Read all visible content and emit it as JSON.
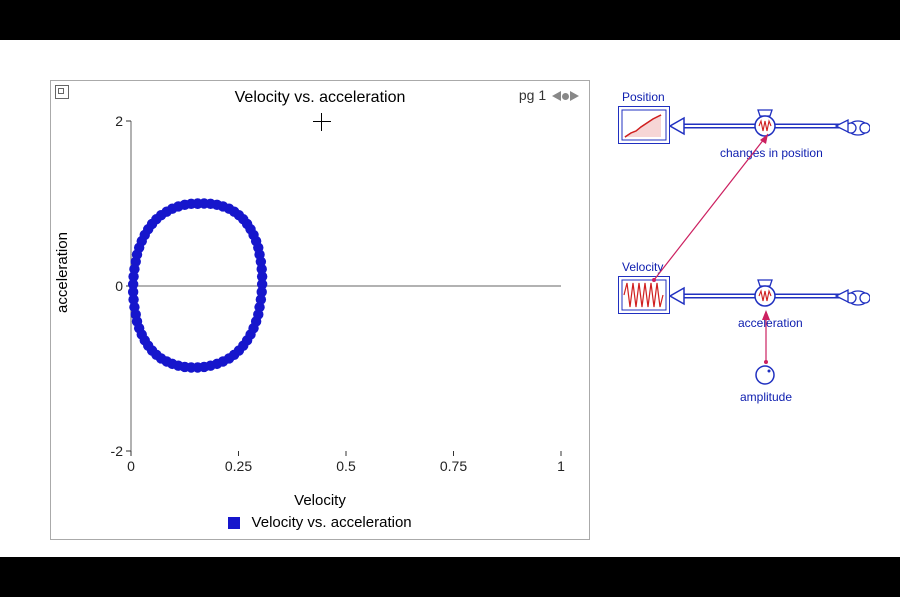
{
  "chart_data": {
    "type": "scatter",
    "title": "Velocity vs. acceleration",
    "xlabel": "Velocity",
    "ylabel": "acceleration",
    "xlim": [
      0,
      1
    ],
    "ylim": [
      -2,
      2
    ],
    "xticks": [
      0,
      0.25,
      0.5,
      0.75,
      1
    ],
    "yticks": [
      -2,
      0,
      2
    ],
    "grid": false,
    "series": [
      {
        "name": "Velocity vs. acceleration",
        "color": "#1616cc",
        "marker": "circle",
        "x": [
          0.155,
          0.14,
          0.125,
          0.11,
          0.096,
          0.083,
          0.07,
          0.059,
          0.049,
          0.04,
          0.032,
          0.025,
          0.019,
          0.014,
          0.011,
          0.008,
          0.006,
          0.005,
          0.005,
          0.006,
          0.008,
          0.011,
          0.014,
          0.019,
          0.025,
          0.032,
          0.04,
          0.049,
          0.059,
          0.07,
          0.083,
          0.096,
          0.11,
          0.125,
          0.14,
          0.155,
          0.17,
          0.185,
          0.2,
          0.214,
          0.228,
          0.24,
          0.251,
          0.261,
          0.27,
          0.278,
          0.285,
          0.291,
          0.296,
          0.299,
          0.302,
          0.304,
          0.305,
          0.305,
          0.304,
          0.302,
          0.299,
          0.296,
          0.291,
          0.285,
          0.278,
          0.27,
          0.261,
          0.251,
          0.24,
          0.228,
          0.214,
          0.2,
          0.185,
          0.17,
          0.155
        ],
        "y": [
          1.0,
          0.996,
          0.984,
          0.964,
          0.937,
          0.901,
          0.858,
          0.809,
          0.752,
          0.688,
          0.619,
          0.544,
          0.465,
          0.381,
          0.294,
          0.205,
          0.114,
          0.021,
          -0.072,
          -0.165,
          -0.256,
          -0.345,
          -0.43,
          -0.511,
          -0.588,
          -0.659,
          -0.724,
          -0.782,
          -0.834,
          -0.878,
          -0.915,
          -0.944,
          -0.966,
          -0.981,
          -0.988,
          -0.988,
          -0.981,
          -0.966,
          -0.944,
          -0.915,
          -0.878,
          -0.834,
          -0.782,
          -0.724,
          -0.659,
          -0.588,
          -0.511,
          -0.43,
          -0.345,
          -0.256,
          -0.165,
          -0.072,
          0.021,
          0.114,
          0.205,
          0.294,
          0.381,
          0.465,
          0.544,
          0.619,
          0.688,
          0.752,
          0.809,
          0.858,
          0.901,
          0.937,
          0.964,
          0.984,
          0.996,
          1.0,
          0.996
        ]
      }
    ],
    "cursor_position": {
      "x": 0.5,
      "y": 1.9
    }
  },
  "chart_ui": {
    "page_label": "pg 1",
    "legend_text": "Velocity vs. acceleration"
  },
  "diagram": {
    "stocks": [
      {
        "id": "position",
        "label": "Position"
      },
      {
        "id": "velocity",
        "label": "Velocity"
      }
    ],
    "flows": [
      {
        "id": "changes_in_position",
        "label": "changes in position",
        "into": "position"
      },
      {
        "id": "acceleration",
        "label": "acceleration",
        "into": "velocity"
      }
    ],
    "converters": [
      {
        "id": "amplitude",
        "label": "amplitude"
      }
    ],
    "links": [
      {
        "from": "velocity",
        "to": "changes_in_position"
      },
      {
        "from": "amplitude",
        "to": "acceleration"
      }
    ]
  }
}
